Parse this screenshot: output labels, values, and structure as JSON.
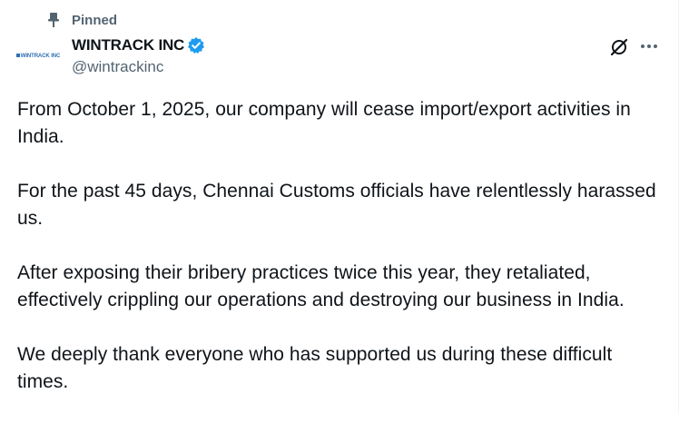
{
  "post": {
    "pinned_label": "Pinned",
    "author": {
      "display_name": "WINTRACK INC",
      "handle": "@wintrackinc",
      "avatar_text": "WINTRACK INC"
    },
    "paragraphs": [
      "From October 1, 2025, our company will cease import/export activities in India.",
      "For the past 45 days, Chennai Customs officials have relentlessly harassed us.",
      "After exposing their bribery practices twice this year, they retaliated, effectively crippling our operations and destroying our business in India.",
      "We deeply thank everyone who has supported us during these difficult times."
    ]
  },
  "icons": {
    "pin": "pin-icon",
    "verified": "verified-badge-icon",
    "grok": "grok-icon",
    "more": "more-options-icon"
  },
  "colors": {
    "text_primary": "#0f1419",
    "text_secondary": "#536471",
    "verified_blue": "#1d9bf0"
  }
}
